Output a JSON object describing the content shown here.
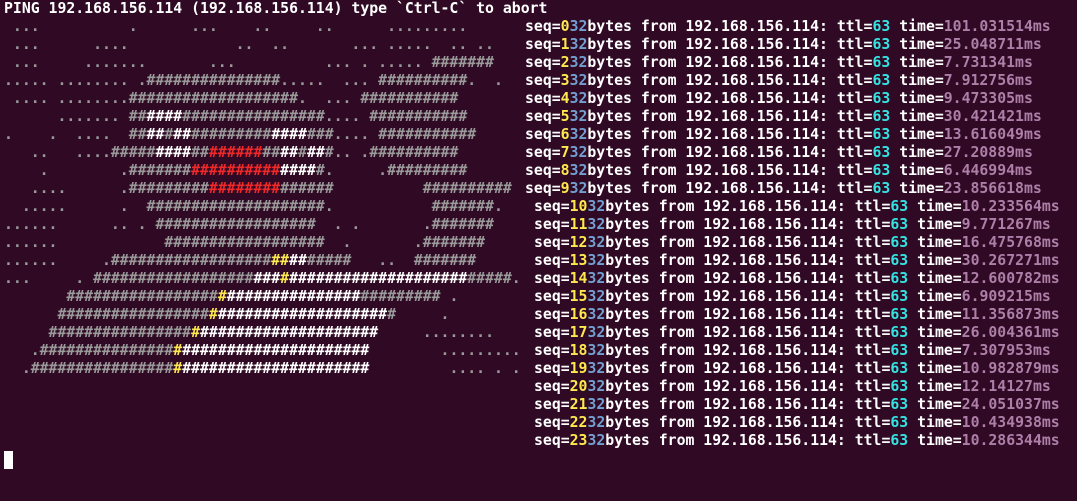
{
  "header": {
    "command": "PING 192.168.156.114 (192.168.156.114) type `Ctrl-C` to abort"
  },
  "colors": {
    "background": "#300a24",
    "text": "#ffffff",
    "art_gray": "#9a9a9a",
    "art_red": "#ef2929",
    "art_yellow": "#fce94f",
    "seq_number": "#fce94f",
    "bytes_number": "#729fcf",
    "ttl_number": "#34e2e2",
    "time_value": "#ad7fa8"
  },
  "ascii_art": [
    [
      [
        "g",
        " ...          .      ...    ..     ..      ........."
      ]
    ],
    [
      [
        "g",
        " ...      ....            ..  ..       ... .....  .. .."
      ]
    ],
    [
      [
        "g",
        " ...     .......       ...          ... . ..... #######"
      ]
    ],
    [
      [
        "g",
        "..... ........ .###############.....  ... ##########.  ."
      ]
    ],
    [
      [
        "g",
        " .... ........###################.  ... ###########"
      ]
    ],
    [
      [
        "g",
        "      ....... ##"
      ],
      [
        "w",
        "####"
      ],
      [
        "g",
        "################.... ###########"
      ]
    ],
    [
      [
        "g",
        ".    .  ....  ##"
      ],
      [
        "w",
        "##"
      ],
      [
        "g",
        "#"
      ],
      [
        "w",
        "##"
      ],
      [
        "g",
        "#########"
      ],
      [
        "w",
        "####"
      ],
      [
        "g",
        "###.... ###########"
      ]
    ],
    [
      [
        "g",
        "   ..   ....#####"
      ],
      [
        "w",
        "####"
      ],
      [
        "g",
        "##"
      ],
      [
        "r",
        "######"
      ],
      [
        "g",
        "##"
      ],
      [
        "w",
        "##"
      ],
      [
        "g",
        "#"
      ],
      [
        "w",
        "##"
      ],
      [
        "g",
        "#.. .##########"
      ]
    ],
    [
      [
        "g",
        "    .        .#######"
      ],
      [
        "r",
        "##########"
      ],
      [
        "w",
        "####"
      ],
      [
        "g",
        "#.     .#########"
      ]
    ],
    [
      [
        "g",
        "   ....      .#########"
      ],
      [
        "r",
        "########"
      ],
      [
        "g",
        "######          ##########"
      ]
    ],
    [
      [
        "g",
        "  .....      .  ####################.           #######."
      ]
    ],
    [
      [
        "g",
        "......      .. . ##################  . .       .#######"
      ]
    ],
    [
      [
        "g",
        "......            ##################  .       .#######"
      ]
    ],
    [
      [
        "g",
        "......     .##################"
      ],
      [
        "y",
        "##"
      ],
      [
        "w",
        "##"
      ],
      [
        "g",
        "#####   ..  #######"
      ]
    ],
    [
      [
        "g",
        "...     . ##################"
      ],
      [
        "w",
        "###"
      ],
      [
        "y",
        "#"
      ],
      [
        "w",
        "####################"
      ],
      [
        "g",
        "#####."
      ]
    ],
    [
      [
        "g",
        "       #################"
      ],
      [
        "y",
        "#"
      ],
      [
        "w",
        "###############"
      ],
      [
        "g",
        "######### ."
      ]
    ],
    [
      [
        "g",
        "      #################"
      ],
      [
        "y",
        "#"
      ],
      [
        "w",
        "###################"
      ],
      [
        "g",
        "#     ."
      ]
    ],
    [
      [
        "g",
        "     ################"
      ],
      [
        "y",
        "#"
      ],
      [
        "w",
        "####################"
      ],
      [
        "g",
        "     ........"
      ]
    ],
    [
      [
        "g",
        "   .###############"
      ],
      [
        "y",
        "#"
      ],
      [
        "w",
        "#####################"
      ],
      [
        "g",
        "        ........."
      ]
    ],
    [
      [
        "g",
        "  .################"
      ],
      [
        "y",
        "#"
      ],
      [
        "w",
        "#####################"
      ],
      [
        "g",
        "         .... . ."
      ]
    ]
  ],
  "ping_responses": [
    {
      "seq_label": "seq=",
      "seq": "0",
      "bytes": "32",
      "bytes_label": "bytes from 192.168.156.114: ttl=",
      "ttl": "63",
      "time_label": "time=",
      "time": "101.031514ms"
    },
    {
      "seq_label": "seq=",
      "seq": "1",
      "bytes": "32",
      "bytes_label": "bytes from 192.168.156.114: ttl=",
      "ttl": "63",
      "time_label": "time=",
      "time": "25.048711ms"
    },
    {
      "seq_label": "seq=",
      "seq": "2",
      "bytes": "32",
      "bytes_label": "bytes from 192.168.156.114: ttl=",
      "ttl": "63",
      "time_label": "time=",
      "time": "7.731341ms"
    },
    {
      "seq_label": "seq=",
      "seq": "3",
      "bytes": "32",
      "bytes_label": "bytes from 192.168.156.114: ttl=",
      "ttl": "63",
      "time_label": "time=",
      "time": "7.912756ms"
    },
    {
      "seq_label": "seq=",
      "seq": "4",
      "bytes": "32",
      "bytes_label": "bytes from 192.168.156.114: ttl=",
      "ttl": "63",
      "time_label": "time=",
      "time": "9.473305ms"
    },
    {
      "seq_label": "seq=",
      "seq": "5",
      "bytes": "32",
      "bytes_label": "bytes from 192.168.156.114: ttl=",
      "ttl": "63",
      "time_label": "time=",
      "time": "30.421421ms"
    },
    {
      "seq_label": "seq=",
      "seq": "6",
      "bytes": "32",
      "bytes_label": "bytes from 192.168.156.114: ttl=",
      "ttl": "63",
      "time_label": "time=",
      "time": "13.616049ms"
    },
    {
      "seq_label": "seq=",
      "seq": "7",
      "bytes": "32",
      "bytes_label": "bytes from 192.168.156.114: ttl=",
      "ttl": "63",
      "time_label": "time=",
      "time": "27.20889ms"
    },
    {
      "seq_label": "seq=",
      "seq": "8",
      "bytes": "32",
      "bytes_label": "bytes from 192.168.156.114: ttl=",
      "ttl": "63",
      "time_label": "time=",
      "time": "6.446994ms"
    },
    {
      "seq_label": "seq=",
      "seq": "9",
      "bytes": "32",
      "bytes_label": "bytes from 192.168.156.114: ttl=",
      "ttl": "63",
      "time_label": "time=",
      "time": "23.856618ms"
    },
    {
      "seq_label": "seq=",
      "seq": "10",
      "bytes": "32",
      "bytes_label": "bytes from 192.168.156.114: ttl=",
      "ttl": "63",
      "time_label": "time=",
      "time": "10.233564ms"
    },
    {
      "seq_label": "seq=",
      "seq": "11",
      "bytes": "32",
      "bytes_label": "bytes from 192.168.156.114: ttl=",
      "ttl": "63",
      "time_label": "time=",
      "time": "9.771267ms"
    },
    {
      "seq_label": "seq=",
      "seq": "12",
      "bytes": "32",
      "bytes_label": "bytes from 192.168.156.114: ttl=",
      "ttl": "63",
      "time_label": "time=",
      "time": "16.475768ms"
    },
    {
      "seq_label": "seq=",
      "seq": "13",
      "bytes": "32",
      "bytes_label": "bytes from 192.168.156.114: ttl=",
      "ttl": "63",
      "time_label": "time=",
      "time": "30.267271ms"
    },
    {
      "seq_label": "seq=",
      "seq": "14",
      "bytes": "32",
      "bytes_label": "bytes from 192.168.156.114: ttl=",
      "ttl": "63",
      "time_label": "time=",
      "time": "12.600782ms"
    },
    {
      "seq_label": "seq=",
      "seq": "15",
      "bytes": "32",
      "bytes_label": "bytes from 192.168.156.114: ttl=",
      "ttl": "63",
      "time_label": "time=",
      "time": "6.909215ms"
    },
    {
      "seq_label": "seq=",
      "seq": "16",
      "bytes": "32",
      "bytes_label": "bytes from 192.168.156.114: ttl=",
      "ttl": "63",
      "time_label": "time=",
      "time": "11.356873ms"
    },
    {
      "seq_label": "seq=",
      "seq": "17",
      "bytes": "32",
      "bytes_label": "bytes from 192.168.156.114: ttl=",
      "ttl": "63",
      "time_label": "time=",
      "time": "26.004361ms"
    },
    {
      "seq_label": "seq=",
      "seq": "18",
      "bytes": "32",
      "bytes_label": "bytes from 192.168.156.114: ttl=",
      "ttl": "63",
      "time_label": "time=",
      "time": "7.307953ms"
    },
    {
      "seq_label": "seq=",
      "seq": "19",
      "bytes": "32",
      "bytes_label": "bytes from 192.168.156.114: ttl=",
      "ttl": "63",
      "time_label": "time=",
      "time": "10.982879ms"
    },
    {
      "seq_label": "seq=",
      "seq": "20",
      "bytes": "32",
      "bytes_label": "bytes from 192.168.156.114: ttl=",
      "ttl": "63",
      "time_label": "time=",
      "time": "12.14127ms"
    },
    {
      "seq_label": "seq=",
      "seq": "21",
      "bytes": "32",
      "bytes_label": "bytes from 192.168.156.114: ttl=",
      "ttl": "63",
      "time_label": "time=",
      "time": "24.051037ms"
    },
    {
      "seq_label": "seq=",
      "seq": "22",
      "bytes": "32",
      "bytes_label": "bytes from 192.168.156.114: ttl=",
      "ttl": "63",
      "time_label": "time=",
      "time": "10.434938ms"
    },
    {
      "seq_label": "seq=",
      "seq": "23",
      "bytes": "32",
      "bytes_label": "bytes from 192.168.156.114: ttl=",
      "ttl": "63",
      "time_label": "time=",
      "time": "10.286344ms"
    }
  ]
}
